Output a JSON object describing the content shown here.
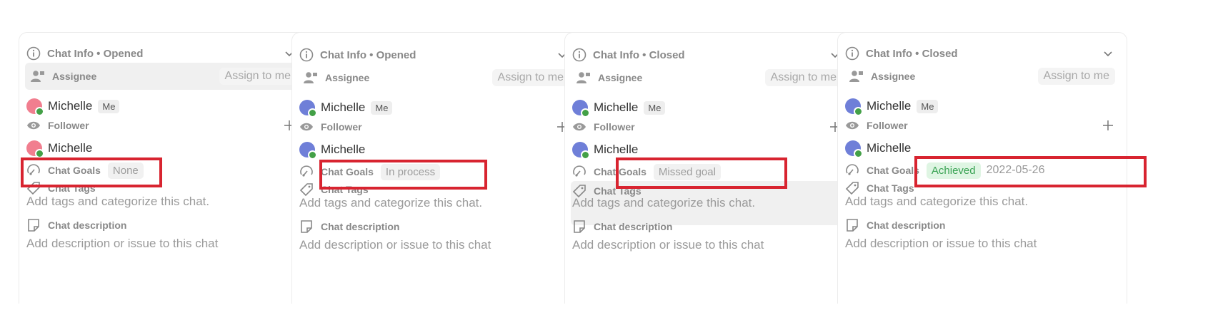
{
  "panels": [
    {
      "header_title": "Chat Info • Opened",
      "assignee_label": "Assignee",
      "assign_button": "Assign to me",
      "assignee_name": "Michelle",
      "assignee_badge": "Me",
      "follower_label": "Follower",
      "follower_name": "Michelle",
      "goals_label": "Chat Goals",
      "goals_status": "None",
      "goals_date": "",
      "tags_label": "Chat Tags",
      "tags_placeholder": "Add tags and categorize this chat.",
      "desc_label": "Chat description",
      "desc_placeholder": "Add description or issue to this chat",
      "avatar_style": "pink",
      "assignee_highlight": true,
      "tags_highlight": false
    },
    {
      "header_title": "Chat Info • Opened",
      "assignee_label": "Assignee",
      "assign_button": "Assign to me",
      "assignee_name": "Michelle",
      "assignee_badge": "Me",
      "follower_label": "Follower",
      "follower_name": "Michelle",
      "goals_label": "Chat Goals",
      "goals_status": "In process",
      "goals_date": "",
      "tags_label": "Chat Tags",
      "tags_placeholder": "Add tags and categorize this chat.",
      "desc_label": "Chat description",
      "desc_placeholder": "Add description or issue to this chat",
      "avatar_style": "blue",
      "assignee_highlight": false,
      "tags_highlight": false
    },
    {
      "header_title": "Chat Info • Closed",
      "assignee_label": "Assignee",
      "assign_button": "Assign to me",
      "assignee_name": "Michelle",
      "assignee_badge": "Me",
      "follower_label": "Follower",
      "follower_name": "Michelle",
      "goals_label": "Chat Goals",
      "goals_status": "Missed goal",
      "goals_date": "",
      "tags_label": "Chat Tags",
      "tags_placeholder": "Add tags and categorize this chat.",
      "desc_label": "Chat description",
      "desc_placeholder": "Add description or issue to this chat",
      "avatar_style": "blue",
      "assignee_highlight": false,
      "tags_highlight": true
    },
    {
      "header_title": "Chat Info • Closed",
      "assignee_label": "Assignee",
      "assign_button": "Assign to me",
      "assignee_name": "Michelle",
      "assignee_badge": "Me",
      "follower_label": "Follower",
      "follower_name": "Michelle",
      "goals_label": "Chat Goals",
      "goals_status": "Achieved",
      "goals_date": "2022-05-26",
      "tags_label": "Chat Tags",
      "tags_placeholder": "Add tags and categorize this chat.",
      "desc_label": "Chat description",
      "desc_placeholder": "Add description or issue to this chat",
      "avatar_style": "blue",
      "assignee_highlight": false,
      "tags_highlight": false
    }
  ],
  "colors": {
    "highlight_box": "#d82430",
    "achieved_bg": "#dff5e3",
    "achieved_text": "#3aa354",
    "online_dot": "#43a047"
  }
}
